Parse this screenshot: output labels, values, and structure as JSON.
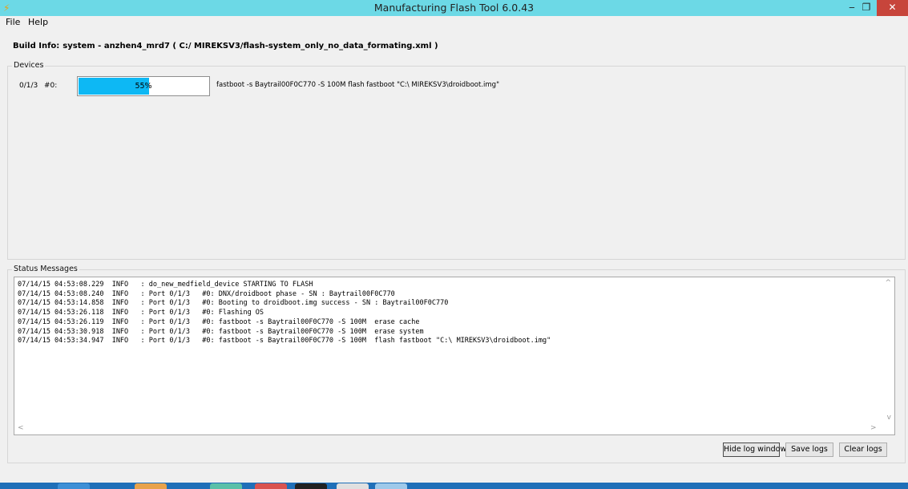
{
  "window": {
    "title": "Manufacturing Flash Tool 6.0.43",
    "app_icon": "lightning-icon",
    "controls": {
      "minimize": "‒",
      "maximize": "❐",
      "close": "✕"
    }
  },
  "menu": {
    "file": "File",
    "help": "Help"
  },
  "build_info": {
    "label": "Build Info:",
    "value": "system - anzhen4_mrd7 ( C:/ MIREKSV3/flash-system_only_no_data_formating.xml )"
  },
  "devices": {
    "title": "Devices",
    "device": {
      "port": "0/1/3",
      "id": "#0:",
      "progress_value": 55,
      "progress_text": "55%",
      "command": "fastboot -s Baytrail00F0C770 -S 100M  flash fastboot \"C:\\ MIREKSV3\\droidboot.img\""
    }
  },
  "status": {
    "title": "Status Messages",
    "log_lines": [
      "07/14/15 04:53:08.229  INFO   : do_new_medfield_device STARTING TO FLASH",
      "07/14/15 04:53:08.240  INFO   : Port 0/1/3   #0: DNX/droidboot phase - SN : Baytrail00F0C770",
      "07/14/15 04:53:14.858  INFO   : Port 0/1/3   #0: Booting to droidboot.img success - SN : Baytrail00F0C770",
      "07/14/15 04:53:26.118  INFO   : Port 0/1/3   #0: Flashing OS",
      "07/14/15 04:53:26.119  INFO   : Port 0/1/3   #0: fastboot -s Baytrail00F0C770 -S 100M  erase cache",
      "07/14/15 04:53:30.918  INFO   : Port 0/1/3   #0: fastboot -s Baytrail00F0C770 -S 100M  erase system",
      "07/14/15 04:53:34.947  INFO   : Port 0/1/3   #0: fastboot -s Baytrail00F0C770 -S 100M  flash fastboot \"C:\\ MIREKSV3\\droidboot.img\""
    ]
  },
  "buttons": {
    "hide_log": "Hide log window",
    "save_logs": "Save logs",
    "clear_logs": "Clear logs"
  },
  "colors": {
    "titlebar": "#6cd9e6",
    "progress_fill": "#0db8f4",
    "close_button": "#c7453b",
    "taskbar": "#1f6fb8"
  }
}
